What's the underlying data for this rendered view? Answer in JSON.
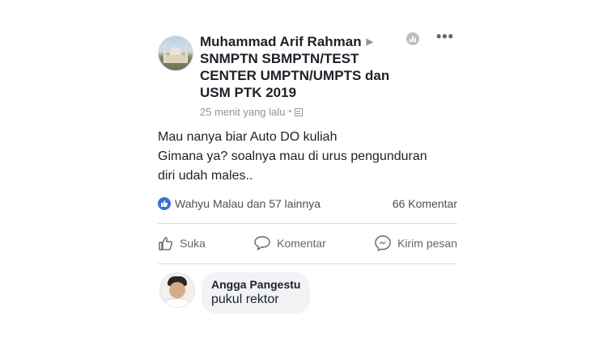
{
  "post": {
    "author": "Muhammad Arif Rahman",
    "group_line_1": "SNMPTN SBMPTN/TEST",
    "group_line_2": "CENTER UMPTN/UMPTS dan",
    "group_line_3": "USM PTK 2019",
    "timestamp": "25 menit yang lalu",
    "text_line_1": "Mau nanya biar Auto DO kuliah",
    "text_line_2": "Gimana ya? soalnya mau di urus pengunduran",
    "text_line_3": "diri udah males..",
    "reactors": "Wahyu Malau dan 57 lainnya",
    "comment_count": "66 Komentar"
  },
  "actions": {
    "like": "Suka",
    "comment": "Komentar",
    "send": "Kirim pesan"
  },
  "comment": {
    "author": "Angga Pangestu",
    "text": "pukul rektor"
  },
  "icons": {
    "like_badge": "thumbs-up-icon",
    "insights": "insights-icon",
    "more": "more-icon",
    "messenger": "messenger-icon"
  },
  "colors": {
    "like_blue": "#3b6fd8",
    "secondary_text": "#8d949e",
    "action_text": "#606770"
  }
}
